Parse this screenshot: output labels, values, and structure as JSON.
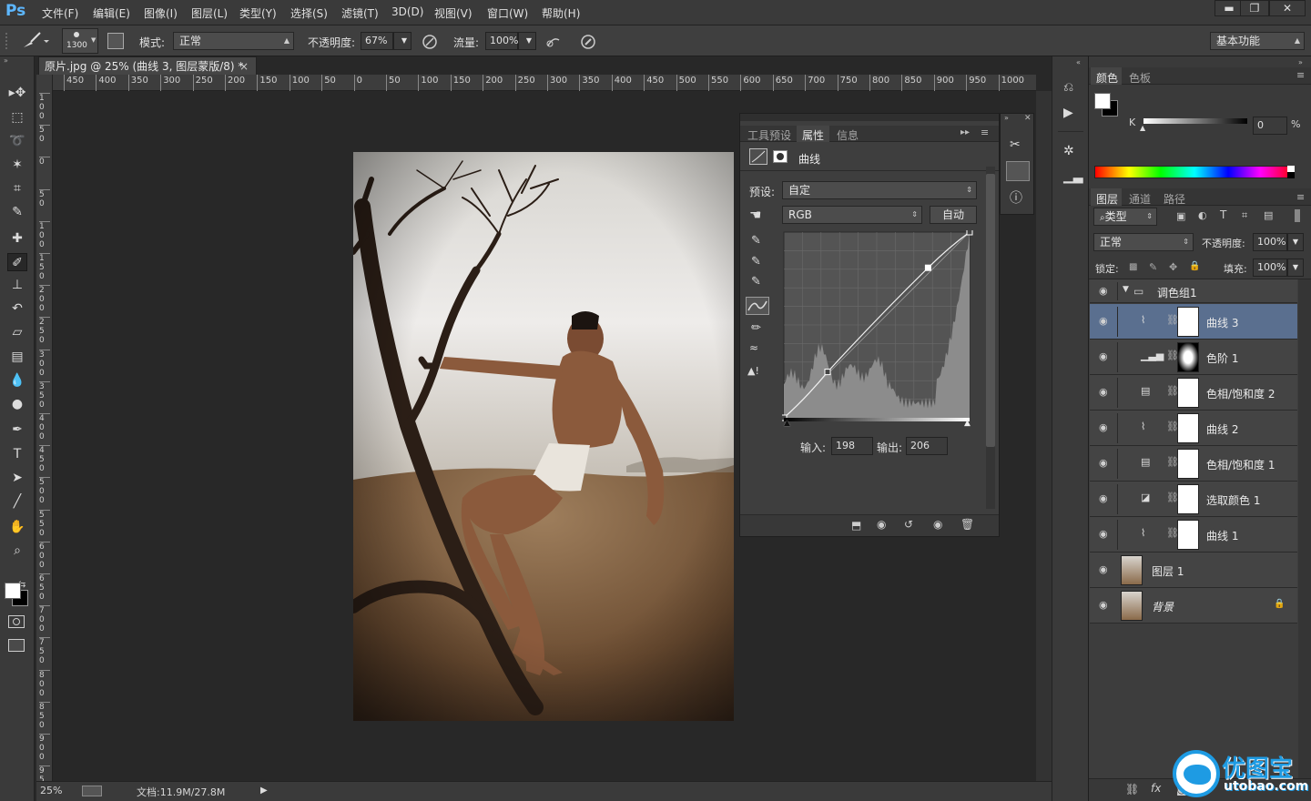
{
  "app": {
    "logo": "Ps"
  },
  "menu": [
    "文件(F)",
    "编辑(E)",
    "图像(I)",
    "图层(L)",
    "类型(Y)",
    "选择(S)",
    "滤镜(T)",
    "3D(D)",
    "视图(V)",
    "窗口(W)",
    "帮助(H)"
  ],
  "window_buttons": [
    "▬",
    "❐",
    "✕"
  ],
  "options": {
    "brush_size": "1300",
    "mode_label": "模式:",
    "mode_value": "正常",
    "opacity_label": "不透明度:",
    "opacity_value": "67%",
    "flow_label": "流量:",
    "flow_value": "100%",
    "workspace": "基本功能"
  },
  "document": {
    "tab_title": "原片.jpg @ 25% (曲线 3, 图层蒙版/8) *",
    "ruler_h": [
      "450",
      "400",
      "350",
      "300",
      "250",
      "200",
      "150",
      "100",
      "50",
      "0",
      "50",
      "100",
      "150",
      "200",
      "250",
      "300",
      "350",
      "400",
      "450",
      "500",
      "550",
      "600",
      "650",
      "700",
      "750",
      "800",
      "850",
      "900",
      "950",
      "1000"
    ],
    "ruler_v": [
      "1\n0\n0",
      "5\n0",
      "0",
      "5\n0",
      "1\n0\n0",
      "1\n5\n0",
      "2\n0\n0",
      "2\n5\n0",
      "3\n0\n0",
      "3\n5\n0",
      "4\n0\n0",
      "4\n5\n0",
      "5\n0\n0",
      "5\n5\n0",
      "6\n0\n0",
      "6\n5\n0",
      "7\n0\n0",
      "7\n5\n0",
      "8\n0\n0",
      "8\n5\n0",
      "9\n0\n0",
      "9\n5\n0"
    ],
    "zoom": "25%",
    "doc_info": "文档:11.9M/27.8M"
  },
  "properties_panel": {
    "tabs": [
      "工具预设",
      "属性",
      "信息"
    ],
    "active_tab": "属性",
    "title": "曲线",
    "preset_label": "预设:",
    "preset_value": "自定",
    "channel_value": "RGB",
    "auto_button": "自动",
    "input_label": "输入:",
    "input_value": "198",
    "output_label": "输出:",
    "output_value": "206",
    "curve_points": [
      [
        0,
        0
      ],
      [
        60,
        63
      ],
      [
        198,
        206
      ],
      [
        255,
        255
      ]
    ]
  },
  "color_panel": {
    "tabs": [
      "颜色",
      "色板"
    ],
    "channel": "K",
    "value": "0",
    "unit": "%"
  },
  "layers_panel": {
    "tabs": [
      "图层",
      "通道",
      "路径"
    ],
    "filter": "类型",
    "blend_mode": "正常",
    "opacity_label": "不透明度:",
    "opacity": "100%",
    "lock_label": "锁定:",
    "fill_label": "填充:",
    "fill": "100%",
    "group_name": "调色组1",
    "layers": [
      {
        "name": "曲线 3",
        "kind": "curves",
        "selected": true
      },
      {
        "name": "色阶 1",
        "kind": "levels",
        "selected": false
      },
      {
        "name": "色相/饱和度 2",
        "kind": "hue",
        "selected": false
      },
      {
        "name": "曲线 2",
        "kind": "curves",
        "selected": false
      },
      {
        "name": "色相/饱和度 1",
        "kind": "hue",
        "selected": false
      },
      {
        "name": "选取颜色 1",
        "kind": "selective",
        "selected": false
      },
      {
        "name": "曲线 1",
        "kind": "curves",
        "selected": false
      }
    ],
    "pixel_layers": [
      {
        "name": "图层 1"
      },
      {
        "name": "背景",
        "locked": true
      }
    ]
  },
  "watermark": {
    "text": "优图宝",
    "url": "utobao.com"
  }
}
